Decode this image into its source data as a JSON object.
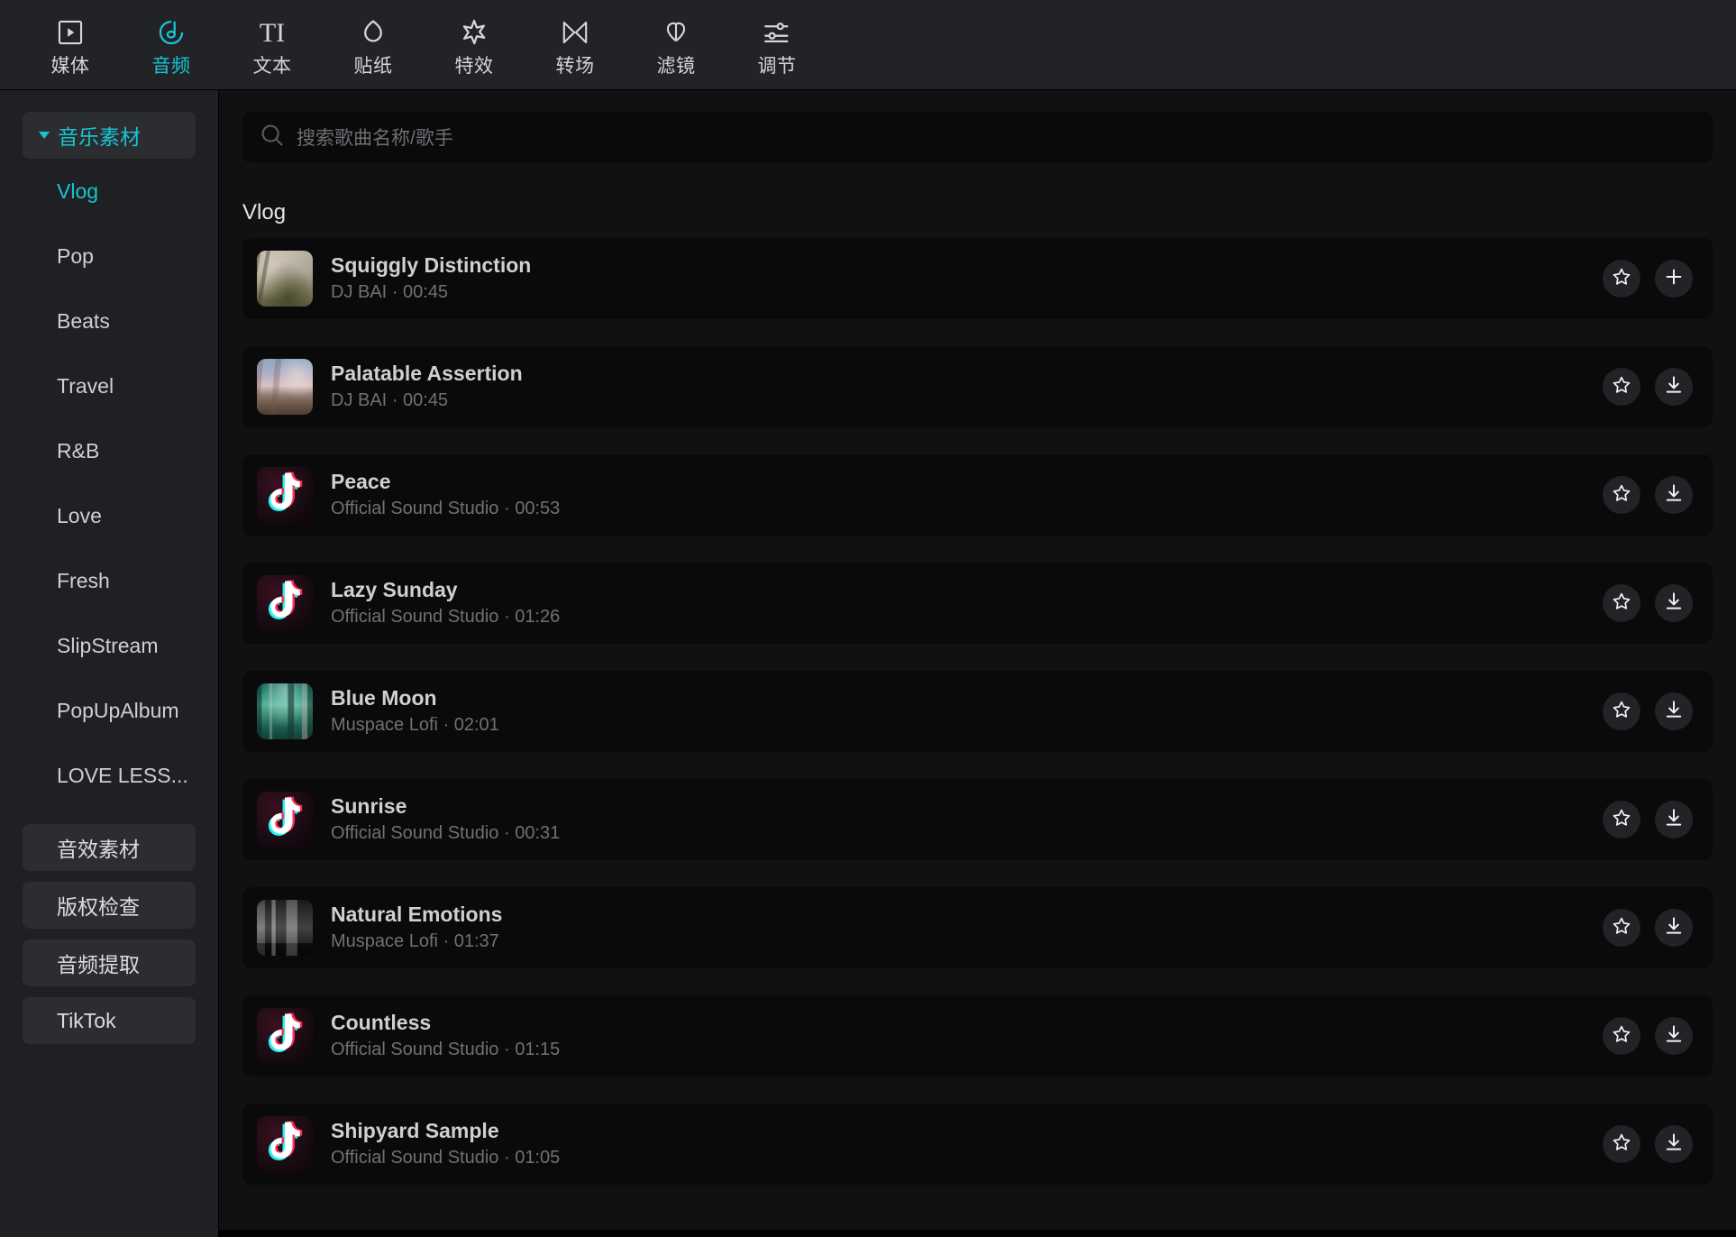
{
  "toolbar": {
    "items": [
      {
        "label": "媒体",
        "icon": "media-icon",
        "active": false
      },
      {
        "label": "音频",
        "icon": "audio-note-icon",
        "active": true
      },
      {
        "label": "文本",
        "icon": "text-ti-icon",
        "active": false
      },
      {
        "label": "贴纸",
        "icon": "sticker-icon",
        "active": false
      },
      {
        "label": "特效",
        "icon": "effects-star-icon",
        "active": false
      },
      {
        "label": "转场",
        "icon": "transition-icon",
        "active": false
      },
      {
        "label": "滤镜",
        "icon": "filter-circles-icon",
        "active": false
      },
      {
        "label": "调节",
        "icon": "adjust-sliders-icon",
        "active": false
      }
    ]
  },
  "sidebar": {
    "group": {
      "label": "音乐素材",
      "expanded": true
    },
    "sub_items": [
      {
        "label": "Vlog",
        "active": true
      },
      {
        "label": "Pop",
        "active": false
      },
      {
        "label": "Beats",
        "active": false
      },
      {
        "label": "Travel",
        "active": false
      },
      {
        "label": "R&B",
        "active": false
      },
      {
        "label": "Love",
        "active": false
      },
      {
        "label": "Fresh",
        "active": false
      },
      {
        "label": "SlipStream",
        "active": false
      },
      {
        "label": "PopUpAlbum",
        "active": false
      },
      {
        "label": "LOVE LESS...",
        "active": false
      }
    ],
    "buttons": [
      {
        "label": "音效素材"
      },
      {
        "label": "版权检查"
      },
      {
        "label": "音频提取"
      },
      {
        "label": "TikTok"
      }
    ]
  },
  "search": {
    "placeholder": "搜索歌曲名称/歌手",
    "value": "",
    "icon": "search-icon"
  },
  "main": {
    "section_title": "Vlog",
    "tracks": [
      {
        "title": "Squiggly Distinction",
        "artist": "DJ BAI",
        "duration": "00:45",
        "subtitle": "DJ BAI · 00:45",
        "art": "painting-landscape-beige",
        "actions": [
          "favorite-icon",
          "add-icon"
        ]
      },
      {
        "title": "Palatable Assertion",
        "artist": "DJ BAI",
        "duration": "00:45",
        "subtitle": "DJ BAI · 00:45",
        "art": "painting-landscape-dusk",
        "actions": [
          "favorite-icon",
          "download-icon"
        ]
      },
      {
        "title": "Peace",
        "artist": "Official Sound Studio",
        "duration": "00:53",
        "subtitle": "Official Sound Studio · 00:53",
        "art": "tiktok-logo",
        "actions": [
          "favorite-icon",
          "download-icon"
        ]
      },
      {
        "title": "Lazy Sunday",
        "artist": "Official Sound Studio",
        "duration": "01:26",
        "subtitle": "Official Sound Studio · 01:26",
        "art": "tiktok-logo",
        "actions": [
          "favorite-icon",
          "download-icon"
        ]
      },
      {
        "title": "Blue Moon",
        "artist": "Muspace Lofi",
        "duration": "02:01",
        "subtitle": "Muspace Lofi · 02:01",
        "art": "photo-train-interior",
        "actions": [
          "favorite-icon",
          "download-icon"
        ]
      },
      {
        "title": "Sunrise",
        "artist": "Official Sound Studio",
        "duration": "00:31",
        "subtitle": "Official Sound Studio · 00:31",
        "art": "tiktok-logo",
        "actions": [
          "favorite-icon",
          "download-icon"
        ]
      },
      {
        "title": "Natural Emotions",
        "artist": "Muspace Lofi",
        "duration": "01:37",
        "subtitle": "Muspace Lofi · 01:37",
        "art": "photo-living-room-bw",
        "actions": [
          "favorite-icon",
          "download-icon"
        ]
      },
      {
        "title": "Countless",
        "artist": "Official Sound Studio",
        "duration": "01:15",
        "subtitle": "Official Sound Studio · 01:15",
        "art": "tiktok-logo",
        "actions": [
          "favorite-icon",
          "download-icon"
        ]
      },
      {
        "title": "Shipyard Sample",
        "artist": "Official Sound Studio",
        "duration": "01:05",
        "subtitle": "Official Sound Studio · 01:05",
        "art": "tiktok-logo",
        "actions": [
          "favorite-icon",
          "download-icon"
        ]
      }
    ]
  },
  "colors": {
    "accent": "#19c4d4",
    "toolbar_bg": "#222326",
    "sidebar_bg": "#1f2023",
    "content_bg": "#111113",
    "row_bg": "#0a0a0b",
    "title_text": "#cfd0d2",
    "sub_text": "#6f7174"
  }
}
